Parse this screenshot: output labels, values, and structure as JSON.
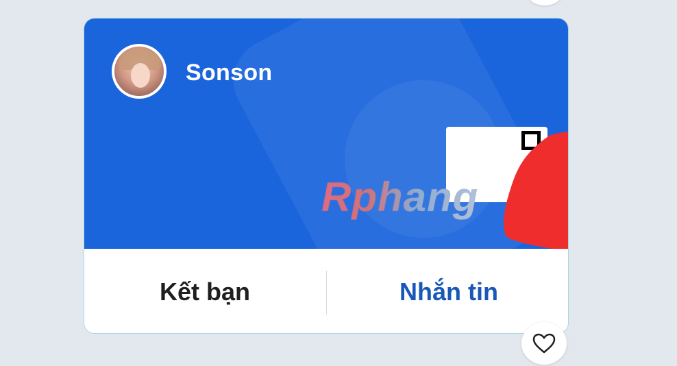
{
  "profile_card": {
    "user_name": "Sonson",
    "watermark_text": "Rphang"
  },
  "actions": {
    "add_friend_label": "Kết bạn",
    "message_label": "Nhắn tin"
  },
  "icons": {
    "like": "heart-icon"
  },
  "colors": {
    "card_blue": "#1b65dc",
    "message_text": "#1a58b8",
    "add_friend_text": "#1f1f1f",
    "background": "#e3e8ef"
  }
}
